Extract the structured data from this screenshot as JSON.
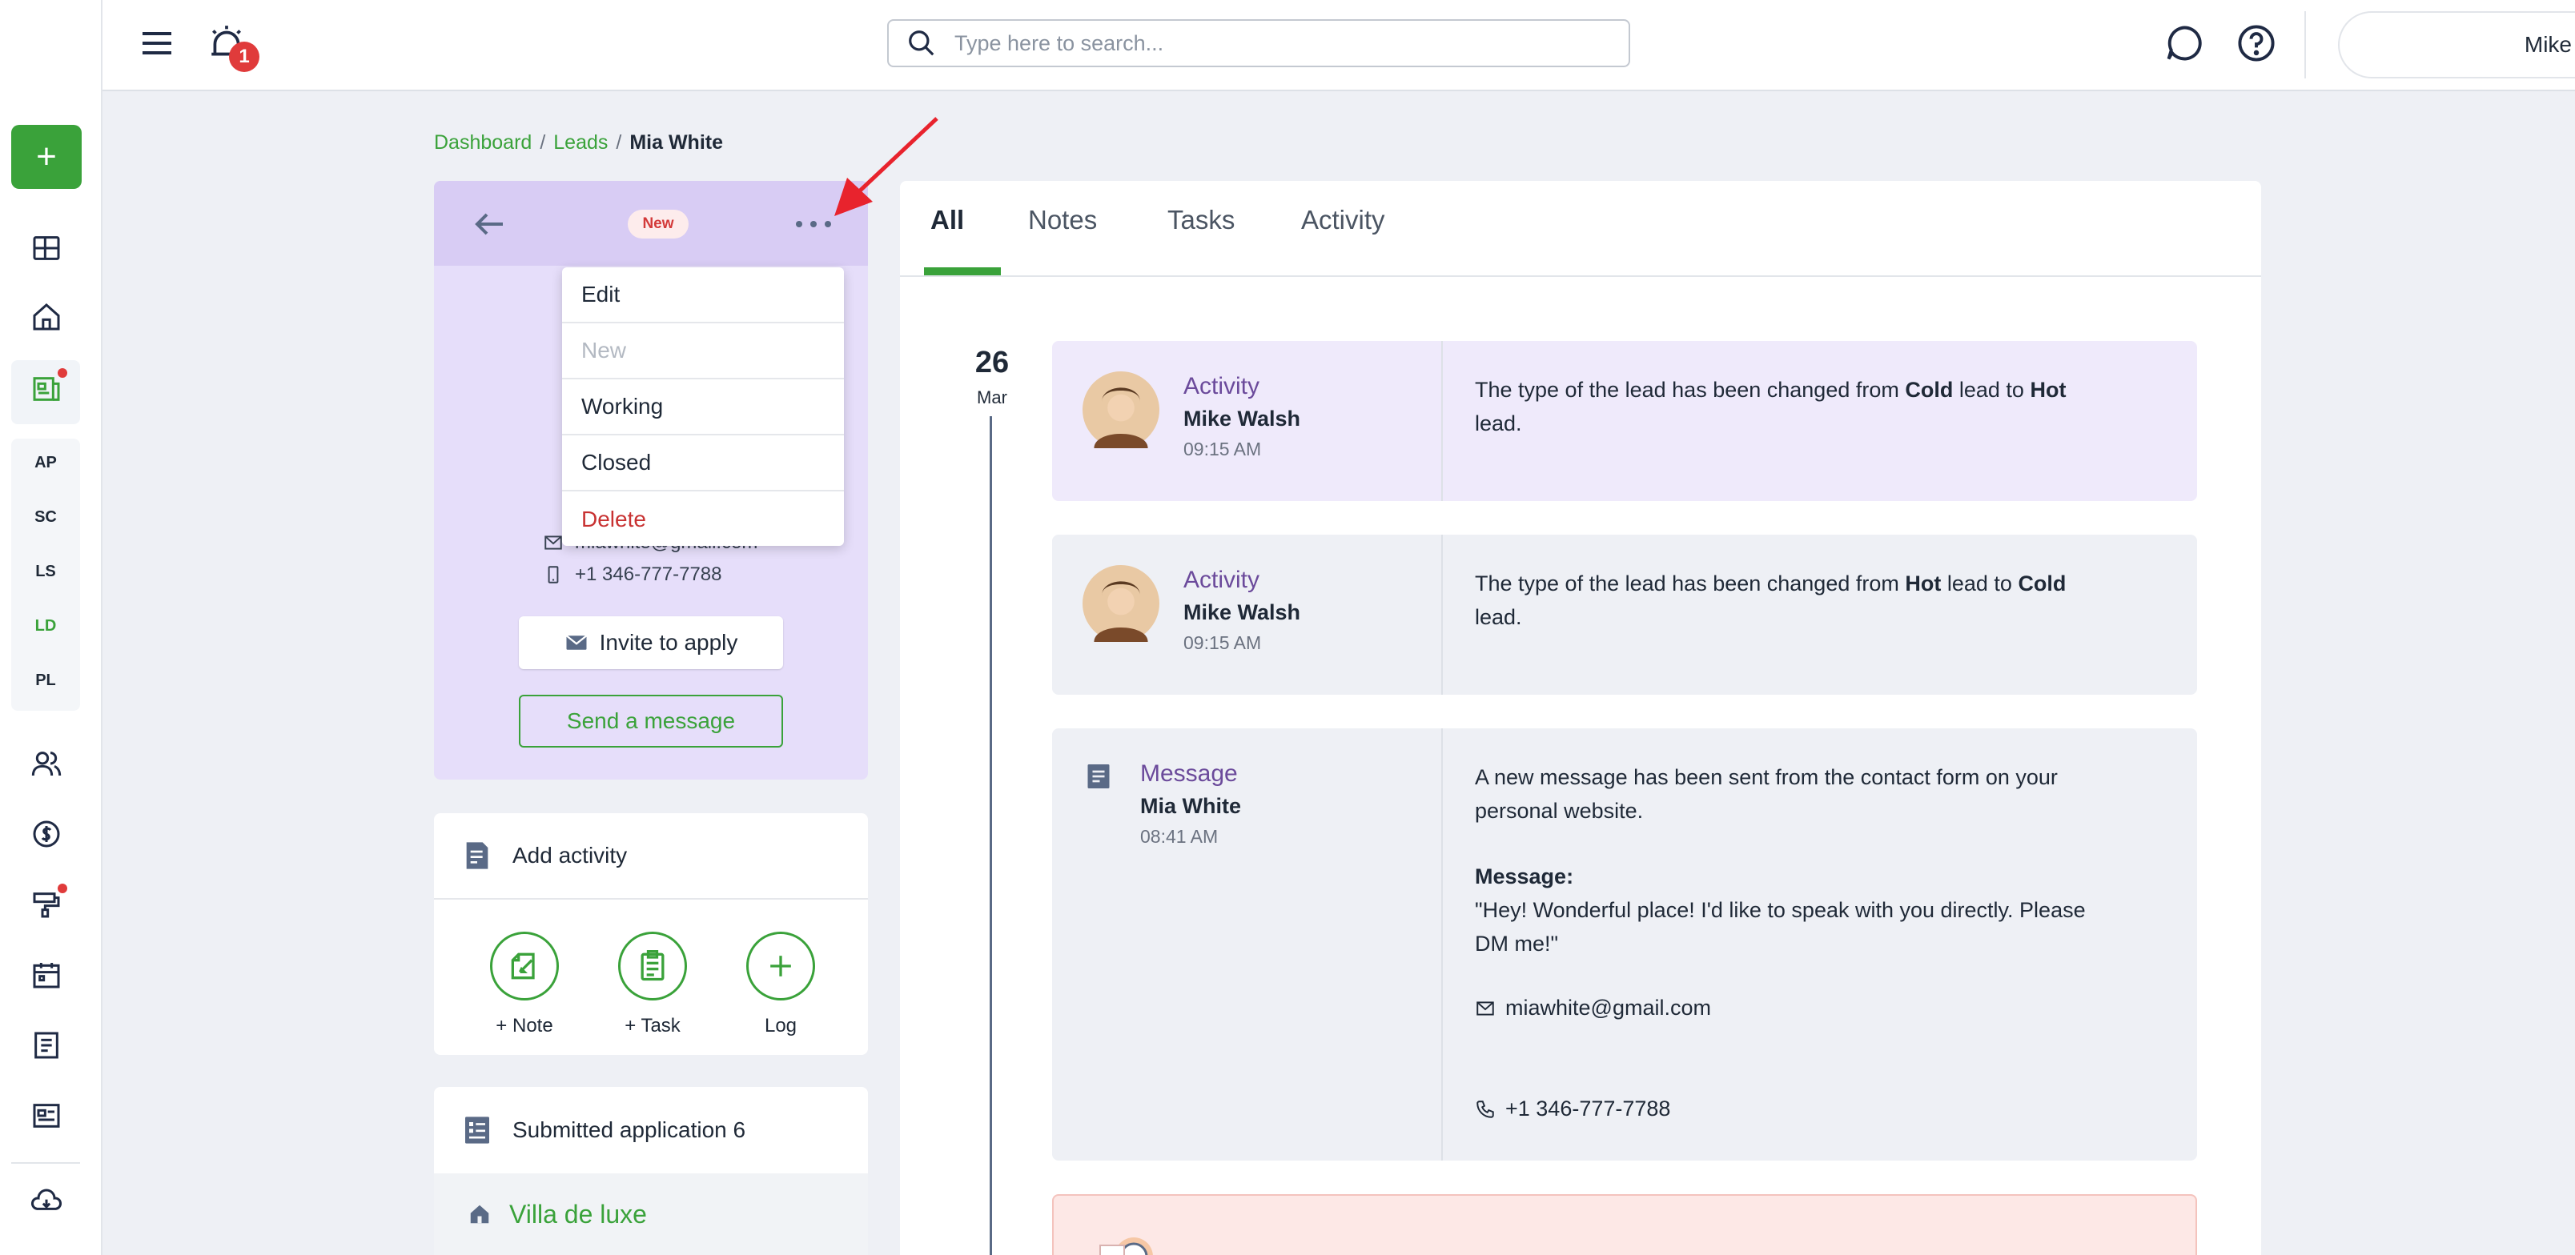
{
  "topbar": {
    "notification_count": "1",
    "search_placeholder": "Type here to search...",
    "user_name": "Mike"
  },
  "rail": {
    "fab_label": "+",
    "abbreviations": [
      "AP",
      "SC",
      "LS",
      "LD",
      "PL"
    ]
  },
  "breadcrumb": {
    "items": [
      "Dashboard",
      "Leads"
    ],
    "separator": "/",
    "current": "Mia White"
  },
  "contact": {
    "status": "New",
    "email": "miawhite@gmail.com",
    "phone": "+1 346-777-7788",
    "invite_label": "Invite to apply",
    "send_message_label": "Send a message"
  },
  "dropdown": {
    "items": [
      "Edit",
      "New",
      "Working",
      "Closed",
      "Delete"
    ]
  },
  "add_activity": {
    "title": "Add activity",
    "actions": [
      "+ Note",
      "+ Task",
      "Log"
    ]
  },
  "submitted": {
    "title": "Submitted application 6",
    "first_item": "Villa de luxe"
  },
  "tabs": [
    "All",
    "Notes",
    "Tasks",
    "Activity"
  ],
  "timeline": {
    "day": "26",
    "month": "Mar",
    "entries": [
      {
        "type": "Activity",
        "author": "Mike Walsh",
        "time": "09:15 AM",
        "text_prefix": "The type of the lead has been changed from ",
        "from": "Cold",
        "middle": " lead to ",
        "to": "Hot",
        "text_suffix": " lead."
      },
      {
        "type": "Activity",
        "author": "Mike Walsh",
        "time": "09:15 AM",
        "text_prefix": "The type of the lead has been changed from ",
        "from": "Hot",
        "middle": " lead to ",
        "to": "Cold",
        "text_suffix": " lead."
      },
      {
        "type": "Message",
        "author": "Mia White",
        "time": "08:41 AM",
        "intro": "A new message has been sent from the contact form on your personal website.",
        "message_label": "Message:",
        "message_body": "\"Hey! Wonderful place! I'd like to speak with you directly. Please DM me!\"",
        "email": "miawhite@gmail.com",
        "phone": "+1 346-777-7788"
      }
    ]
  },
  "colors": {
    "accent_green": "#3aa23a",
    "badge_red": "#e03b3b",
    "card_purple": "#e6defa",
    "activity_purple": "#6b4a9b",
    "annotation_arrow": "#e8232d"
  }
}
